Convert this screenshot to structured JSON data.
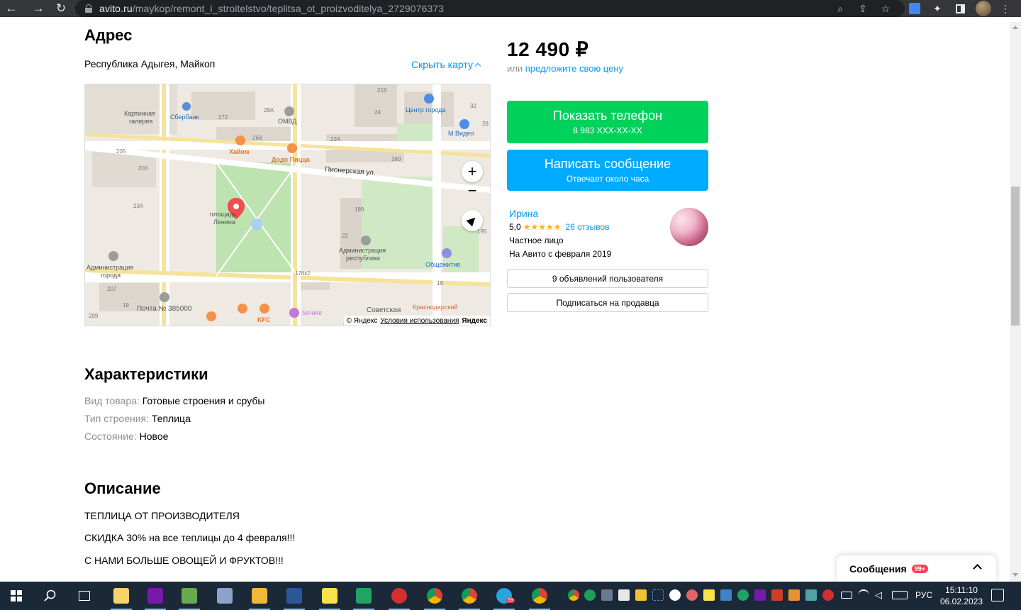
{
  "browser": {
    "url_host": "avito.ru",
    "url_path": "/maykop/remont_i_stroitelstvo/teplitsa_ot_proizvoditelya_2729076373"
  },
  "address": {
    "title": "Адрес",
    "text": "Республика Адыгея, Майкоп",
    "hide_map": "Скрыть карту"
  },
  "map": {
    "labels": {
      "gallery1": "Картинная",
      "gallery2": "галерея",
      "sberbank": "Сбербанк",
      "omvd": "ОМВД",
      "center": "Центр города",
      "mvideo": "М.Видео",
      "hayam": "Хайям",
      "dodo": "Додо Пицца",
      "street": "Пионерская ул.",
      "square1": "площадь",
      "square2": "Ленина",
      "admin1": "Администрация",
      "admin2": "республики",
      "admin_city1": "Администрация",
      "admin_city2": "города",
      "dorm": "Общежитие",
      "post": "Почта № 385000",
      "kfc": "KFC",
      "smoke": "Smoke",
      "krasnodar": "Краснодарский",
      "sovet": "Советская",
      "n215": "215",
      "n24": "24",
      "n272": "272",
      "n28a": "28А",
      "n268": "268",
      "n22a": "22А",
      "n205": "205",
      "n203": "203",
      "n260": "260",
      "n23a": "23А",
      "n199": "199",
      "n22": "22",
      "n207": "207",
      "n19": "19",
      "n209": "209",
      "n176k2": "176к2",
      "n18": "18",
      "n195a": "195",
      "n32": "32",
      "n28": "28",
      "n195b": "195"
    },
    "footer": {
      "copy": "© Яндекс",
      "terms": "Условия использования",
      "brand": "Яндекс"
    },
    "zoom_in": "+",
    "zoom_out": "−"
  },
  "price": {
    "value": "12 490 ₽",
    "or": "или",
    "offer": "предложите свою цену"
  },
  "actions": {
    "phone_title": "Показать телефон",
    "phone_number": "8 983 XXX-XX-XX",
    "message_title": "Написать сообщение",
    "message_sub": "Отвечает около часа"
  },
  "seller": {
    "name": "Ирина",
    "rating": "5,0",
    "stars": "★★★★★",
    "reviews": "26 отзывов",
    "type": "Частное лицо",
    "since": "На Авито с февраля 2019",
    "ads_button": "9 объявлений пользователя",
    "subscribe_button": "Подписаться на продавца"
  },
  "specs": {
    "title": "Характеристики",
    "rows": [
      {
        "k": "Вид товара:",
        "v": "Готовые строения и срубы"
      },
      {
        "k": "Тип строения:",
        "v": "Теплица"
      },
      {
        "k": "Состояние:",
        "v": "Новое"
      }
    ]
  },
  "description": {
    "title": "Описание",
    "lines": [
      "ТЕПЛИЦА ОТ ПРОИЗВОДИТЕЛЯ",
      "СКИДКА 30% на все теплицы до 4 февраля!!!",
      "С НАМИ БОЛЬШЕ ОВОЩЕЙ И ФРУКТОВ!!!"
    ]
  },
  "messages": {
    "label": "Сообщения",
    "badge": "99+"
  },
  "taskbar": {
    "lang": "РУС",
    "time": "15:11:10",
    "date": "06.02.2023",
    "telegram_badge": "59"
  },
  "colors": {
    "accent_link": "#0099f7",
    "phone_green": "#02d15c",
    "message_blue": "#00aaff",
    "star": "#ffb021",
    "badge_red": "#ff4053"
  }
}
